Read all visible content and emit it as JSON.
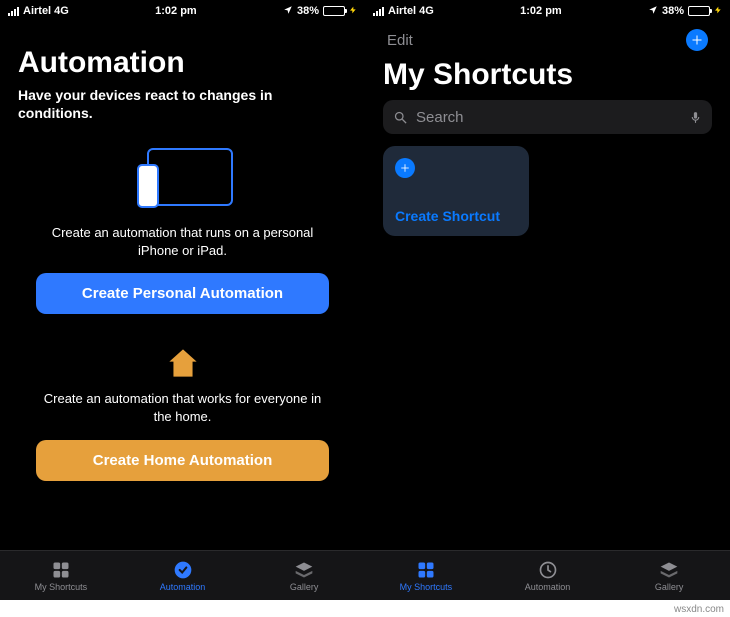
{
  "status": {
    "carrier": "Airtel 4G",
    "time": "1:02 pm",
    "battery_pct": "38%"
  },
  "left": {
    "title": "Automation",
    "subtitle": "Have your devices react to changes in conditions.",
    "personal": {
      "desc": "Create an automation that runs on a personal iPhone or iPad.",
      "button": "Create Personal Automation"
    },
    "home": {
      "desc": "Create an automation that works for everyone in the home.",
      "button": "Create Home Automation"
    },
    "tabs": {
      "shortcuts": "My Shortcuts",
      "automation": "Automation",
      "gallery": "Gallery"
    }
  },
  "right": {
    "edit": "Edit",
    "title": "My Shortcuts",
    "search_placeholder": "Search",
    "card_label": "Create Shortcut",
    "tabs": {
      "shortcuts": "My Shortcuts",
      "automation": "Automation",
      "gallery": "Gallery"
    }
  },
  "watermark": "wsxdn.com"
}
